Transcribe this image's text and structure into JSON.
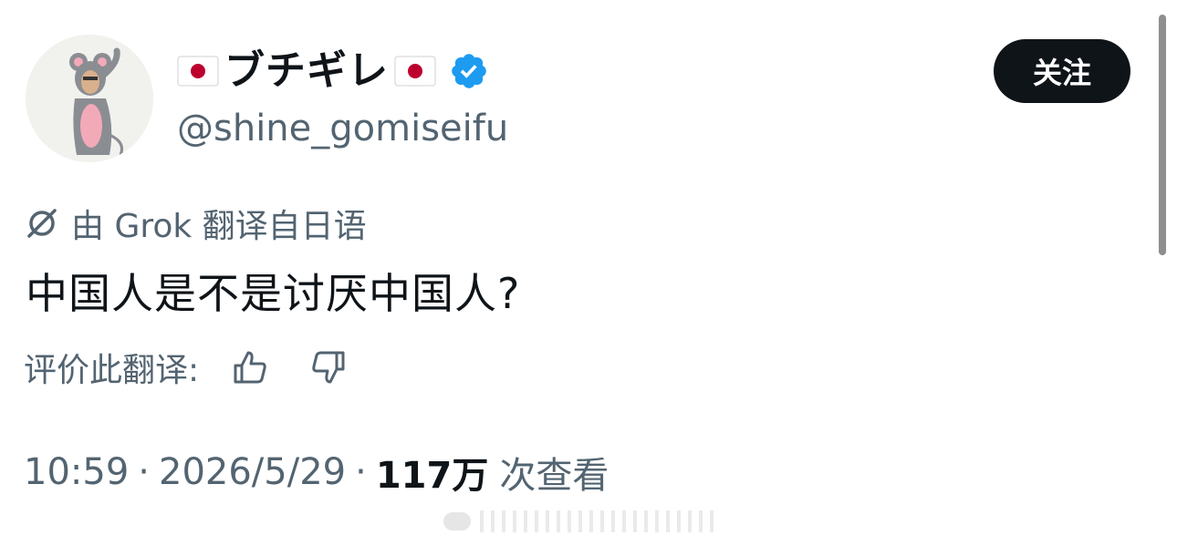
{
  "profile": {
    "flag_left": "🇯🇵",
    "display_name": "ブチギレ",
    "flag_right": "🇯🇵",
    "verified_icon": "verified-badge-icon",
    "handle": "@shine_gomiseifu"
  },
  "actions": {
    "follow_label": "关注"
  },
  "translation": {
    "icon": "grok-icon",
    "notice": "由 Grok 翻译自日语"
  },
  "tweet": {
    "text": "中国人是不是讨厌中国人?"
  },
  "rating": {
    "label": "评价此翻译:",
    "thumbs_up_icon": "thumbs-up-icon",
    "thumbs_down_icon": "thumbs-down-icon"
  },
  "meta": {
    "time": "10:59",
    "separator": "·",
    "date": "2026/5/29",
    "views_count": "117万",
    "views_label": "次查看"
  },
  "colors": {
    "text_primary": "#0f1419",
    "text_secondary": "#536471",
    "verified_blue": "#1d9bf0",
    "button_bg": "#0f1419",
    "flag_red": "#bc002d"
  }
}
